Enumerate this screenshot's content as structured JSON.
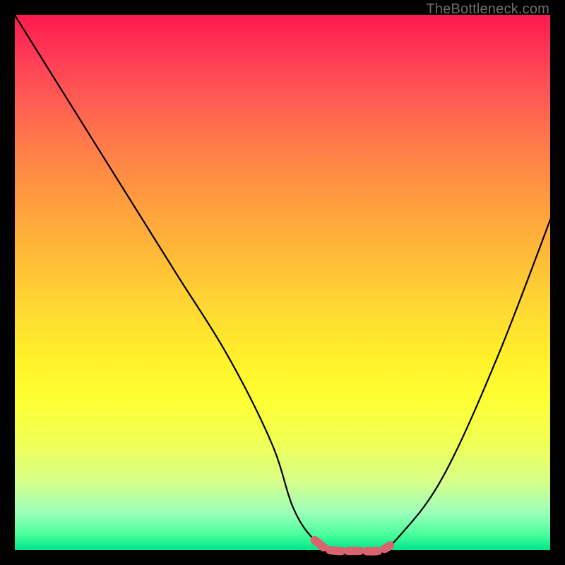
{
  "watermark": "TheBottleneck.com",
  "chart_data": {
    "type": "line",
    "title": "",
    "xlabel": "",
    "ylabel": "",
    "xlim": [
      0,
      100
    ],
    "ylim": [
      0,
      100
    ],
    "series": [
      {
        "name": "bottleneck-curve",
        "x": [
          0,
          10,
          20,
          30,
          40,
          48,
          52,
          56,
          60,
          64,
          68,
          72,
          80,
          90,
          100
        ],
        "y": [
          100,
          84,
          68,
          52,
          36,
          20,
          8,
          2,
          0,
          0,
          0,
          3,
          14,
          36,
          62
        ]
      }
    ],
    "highlight_region": {
      "name": "optimal-zone",
      "x": [
        56,
        58,
        60,
        64,
        68,
        70
      ],
      "y": [
        2,
        0.5,
        0,
        0,
        0,
        1
      ]
    },
    "colors": {
      "curve": "#000000",
      "highlight": "#d9636e",
      "gradient_top": "#ff1a4d",
      "gradient_bottom": "#00e58a"
    }
  }
}
